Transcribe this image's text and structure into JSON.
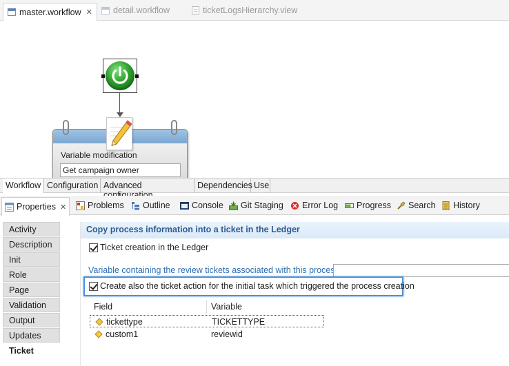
{
  "editor_tabs": [
    {
      "label": "master.workflow",
      "active": true
    },
    {
      "label": "detail.workflow",
      "active": false
    },
    {
      "label": "ticketLogsHierarchy.view",
      "active": false
    }
  ],
  "workflow": {
    "task_title": "Variable modification",
    "task_value": "Get campaign owner"
  },
  "editor_bottom_tabs": [
    "Workflow",
    "Configuration",
    "Advanced configuration",
    "Dependencies",
    "Use"
  ],
  "view_tabs": [
    {
      "label": "Properties",
      "icon": "properties-icon",
      "active": true
    },
    {
      "label": "Problems",
      "icon": "problems-icon"
    },
    {
      "label": "Outline",
      "icon": "outline-icon"
    },
    {
      "label": "Console",
      "icon": "console-icon"
    },
    {
      "label": "Git Staging",
      "icon": "git-staging-icon"
    },
    {
      "label": "Error Log",
      "icon": "error-log-icon"
    },
    {
      "label": "Progress",
      "icon": "progress-icon"
    },
    {
      "label": "Search",
      "icon": "search-icon"
    },
    {
      "label": "History",
      "icon": "history-icon"
    }
  ],
  "nav_items": [
    "Activity",
    "Description",
    "Init",
    "Role",
    "Page",
    "Validation",
    "Output",
    "Updates",
    "Ticket"
  ],
  "active_nav": "Ticket",
  "section": {
    "title": "Copy process information into a ticket in the Ledger",
    "ticket_creation_label": "Ticket creation in the Ledger",
    "ticket_creation_checked": true,
    "variable_label": "Variable containing the review tickets associated with this process",
    "variable_value": "",
    "create_action_label": "Create also the ticket action for the initial task which triggered the process creation",
    "create_action_checked": true
  },
  "table": {
    "columns": [
      "Field",
      "Variable"
    ],
    "rows": [
      {
        "field": "tickettype",
        "variable": "TICKETTYPE",
        "selected": true
      },
      {
        "field": "custom1",
        "variable": "reviewid",
        "selected": false
      }
    ]
  }
}
